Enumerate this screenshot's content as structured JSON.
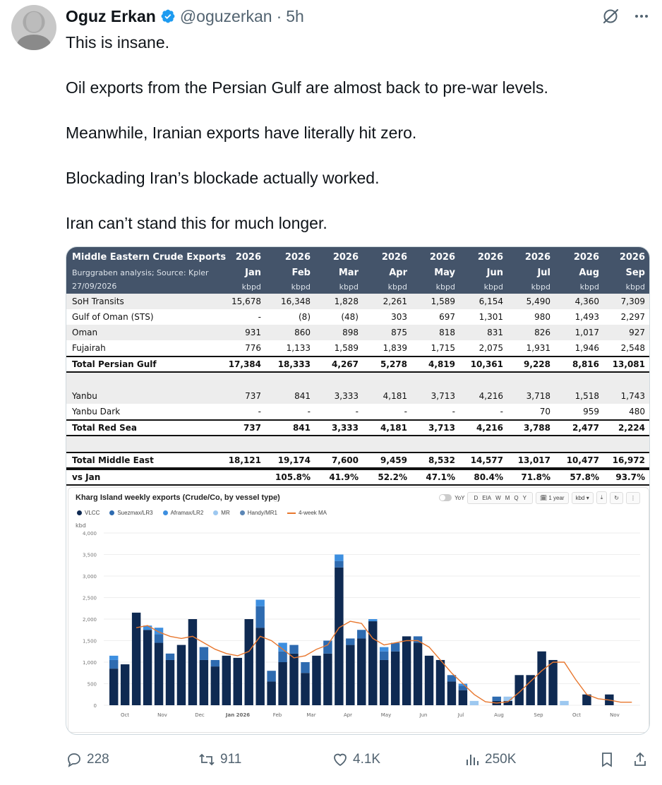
{
  "author": {
    "name": "Oguz Erkan",
    "handle": "@oguzerkan",
    "separator": "·",
    "time": "5h"
  },
  "tweet": {
    "lines": [
      "This is insane.",
      "Oil exports from the Persian Gulf are almost back to pre-war levels.",
      "Meanwhile, Iranian exports have literally hit zero.",
      "Blockading Iran’s blockade actually worked.",
      "Iran can’t stand this for much longer."
    ]
  },
  "table": {
    "title": "Middle Eastern Crude Exports",
    "subtitle": "Burggraben analysis; Source: Kpler",
    "date": "27/09/2026",
    "years": [
      "2026",
      "2026",
      "2026",
      "2026",
      "2026",
      "2026",
      "2026",
      "2026",
      "2026"
    ],
    "months": [
      "Jan",
      "Feb",
      "Mar",
      "Apr",
      "May",
      "Jun",
      "Jul",
      "Aug",
      "Sep"
    ],
    "units": [
      "kbpd",
      "kbpd",
      "kbpd",
      "kbpd",
      "kbpd",
      "kbpd",
      "kbpd",
      "kbpd",
      "kbpd"
    ],
    "rows": [
      {
        "label": "SoH Transits",
        "values": [
          "15,678",
          "16,348",
          "1,828",
          "2,261",
          "1,589",
          "6,154",
          "5,490",
          "4,360",
          "7,309"
        ],
        "style": "alt"
      },
      {
        "label": "Gulf of Oman (STS)",
        "values": [
          "-",
          "(8)",
          "(48)",
          "303",
          "697",
          "1,301",
          "980",
          "1,493",
          "2,297"
        ],
        "style": ""
      },
      {
        "label": "Oman",
        "values": [
          "931",
          "860",
          "898",
          "875",
          "818",
          "831",
          "826",
          "1,017",
          "927"
        ],
        "style": "alt"
      },
      {
        "label": "Fujairah",
        "values": [
          "776",
          "1,133",
          "1,589",
          "1,839",
          "1,715",
          "2,075",
          "1,931",
          "1,946",
          "2,548"
        ],
        "style": ""
      },
      {
        "label": "Total Persian Gulf",
        "values": [
          "17,384",
          "18,333",
          "4,267",
          "5,278",
          "4,819",
          "10,361",
          "9,228",
          "8,816",
          "13,081"
        ],
        "style": "total"
      },
      {
        "label": "",
        "values": [
          "",
          "",
          "",
          "",
          "",
          "",
          "",
          "",
          ""
        ],
        "style": "blank"
      },
      {
        "label": "Yanbu",
        "values": [
          "737",
          "841",
          "3,333",
          "4,181",
          "3,713",
          "4,216",
          "3,718",
          "1,518",
          "1,743"
        ],
        "style": "alt"
      },
      {
        "label": "Yanbu Dark",
        "values": [
          "-",
          "-",
          "-",
          "-",
          "-",
          "-",
          "70",
          "959",
          "480"
        ],
        "style": ""
      },
      {
        "label": "Total Red Sea",
        "values": [
          "737",
          "841",
          "3,333",
          "4,181",
          "3,713",
          "4,216",
          "3,788",
          "2,477",
          "2,224"
        ],
        "style": "total"
      },
      {
        "label": "",
        "values": [
          "",
          "",
          "",
          "",
          "",
          "",
          "",
          "",
          ""
        ],
        "style": "blank"
      },
      {
        "label": "Total Middle East",
        "values": [
          "18,121",
          "19,174",
          "7,600",
          "9,459",
          "8,532",
          "14,577",
          "13,017",
          "10,477",
          "16,972"
        ],
        "style": "total"
      },
      {
        "label": "vs Jan",
        "values": [
          "",
          "105.8%",
          "41.9%",
          "52.2%",
          "47.1%",
          "80.4%",
          "71.8%",
          "57.8%",
          "93.7%"
        ],
        "style": "total"
      }
    ]
  },
  "chart_data": {
    "type": "bar",
    "title": "Kharg Island weekly exports (Crude/Co, by vessel type)",
    "ylabel": "kbd",
    "ylim": [
      0,
      4000
    ],
    "yticks": [
      "0",
      "500",
      "1,000",
      "1,500",
      "2,000",
      "2,500",
      "3,000",
      "3,500",
      "4,000"
    ],
    "xticks": [
      "Oct",
      "Nov",
      "Dec",
      "Jan 2026",
      "Feb",
      "Mar",
      "Apr",
      "May",
      "Jun",
      "Jul",
      "Aug",
      "Sep",
      "Oct",
      "Nov"
    ],
    "series": [
      {
        "name": "VLCC",
        "color": "#0f2a52",
        "values": [
          850,
          950,
          2150,
          1750,
          1450,
          1050,
          1400,
          2000,
          1050,
          900,
          1150,
          1100,
          2000,
          1800,
          550,
          1000,
          1200,
          750,
          1150,
          1200,
          3200,
          1400,
          1550,
          1950,
          1050,
          1250,
          1600,
          1450,
          1150,
          1050,
          550,
          350,
          0,
          0,
          100,
          100,
          700,
          700,
          1250,
          1050,
          0,
          0,
          250,
          0,
          250,
          0,
          0
        ],
        "weeks": 47
      },
      {
        "name": "Suezmax/LR3",
        "color": "#2e6bb0",
        "values": [
          200,
          0,
          0,
          0,
          200,
          150,
          0,
          0,
          300,
          150,
          0,
          0,
          0,
          500,
          250,
          250,
          200,
          250,
          0,
          300,
          150,
          150,
          200,
          0,
          200,
          200,
          0,
          150,
          0,
          0,
          150,
          100,
          0,
          0,
          100,
          0,
          0,
          0,
          0,
          0,
          0,
          0,
          0,
          0,
          0,
          0,
          0
        ]
      },
      {
        "name": "Aframax/LR2",
        "color": "#3d8fe0",
        "values": [
          100,
          0,
          0,
          100,
          150,
          0,
          0,
          0,
          0,
          0,
          0,
          0,
          0,
          150,
          0,
          200,
          0,
          0,
          0,
          0,
          150,
          0,
          0,
          50,
          100,
          0,
          0,
          0,
          0,
          0,
          0,
          50,
          0,
          0,
          0,
          0,
          0,
          0,
          0,
          0,
          0,
          0,
          0,
          0,
          0,
          0,
          0
        ]
      },
      {
        "name": "MR",
        "color": "#9dc8f0",
        "values": [
          0,
          0,
          0,
          0,
          0,
          0,
          0,
          0,
          0,
          0,
          0,
          0,
          0,
          0,
          0,
          0,
          0,
          0,
          0,
          0,
          0,
          0,
          0,
          0,
          0,
          0,
          0,
          0,
          0,
          0,
          0,
          0,
          100,
          0,
          0,
          100,
          0,
          0,
          0,
          0,
          100,
          0,
          0,
          0,
          0,
          0,
          0
        ]
      },
      {
        "name": "Handy/MR1",
        "color": "#5b86b5",
        "values": [
          0,
          0,
          0,
          0,
          0,
          0,
          0,
          0,
          0,
          0,
          0,
          0,
          0,
          0,
          0,
          0,
          0,
          0,
          0,
          0,
          0,
          0,
          0,
          0,
          0,
          0,
          0,
          0,
          0,
          0,
          0,
          0,
          0,
          0,
          0,
          0,
          0,
          0,
          0,
          0,
          0,
          0,
          0,
          0,
          0,
          0,
          0
        ]
      },
      {
        "name": "4-week MA",
        "color": "#e8772e",
        "line": true,
        "values": [
          null,
          null,
          1800,
          1850,
          1700,
          1600,
          1550,
          1600,
          1450,
          1300,
          1200,
          1150,
          1250,
          1600,
          1500,
          1300,
          1100,
          1150,
          1300,
          1400,
          1800,
          1950,
          1900,
          1550,
          1400,
          1450,
          1500,
          1500,
          1350,
          1050,
          750,
          500,
          250,
          80,
          50,
          80,
          300,
          550,
          800,
          1000,
          1000,
          600,
          250,
          150,
          120,
          70,
          70
        ]
      }
    ],
    "controls": {
      "yoy": "YoY",
      "freq": [
        "D",
        "EIA",
        "W",
        "M",
        "Q",
        "Y"
      ],
      "range": "1 year",
      "unit": "kbd"
    }
  }
}
